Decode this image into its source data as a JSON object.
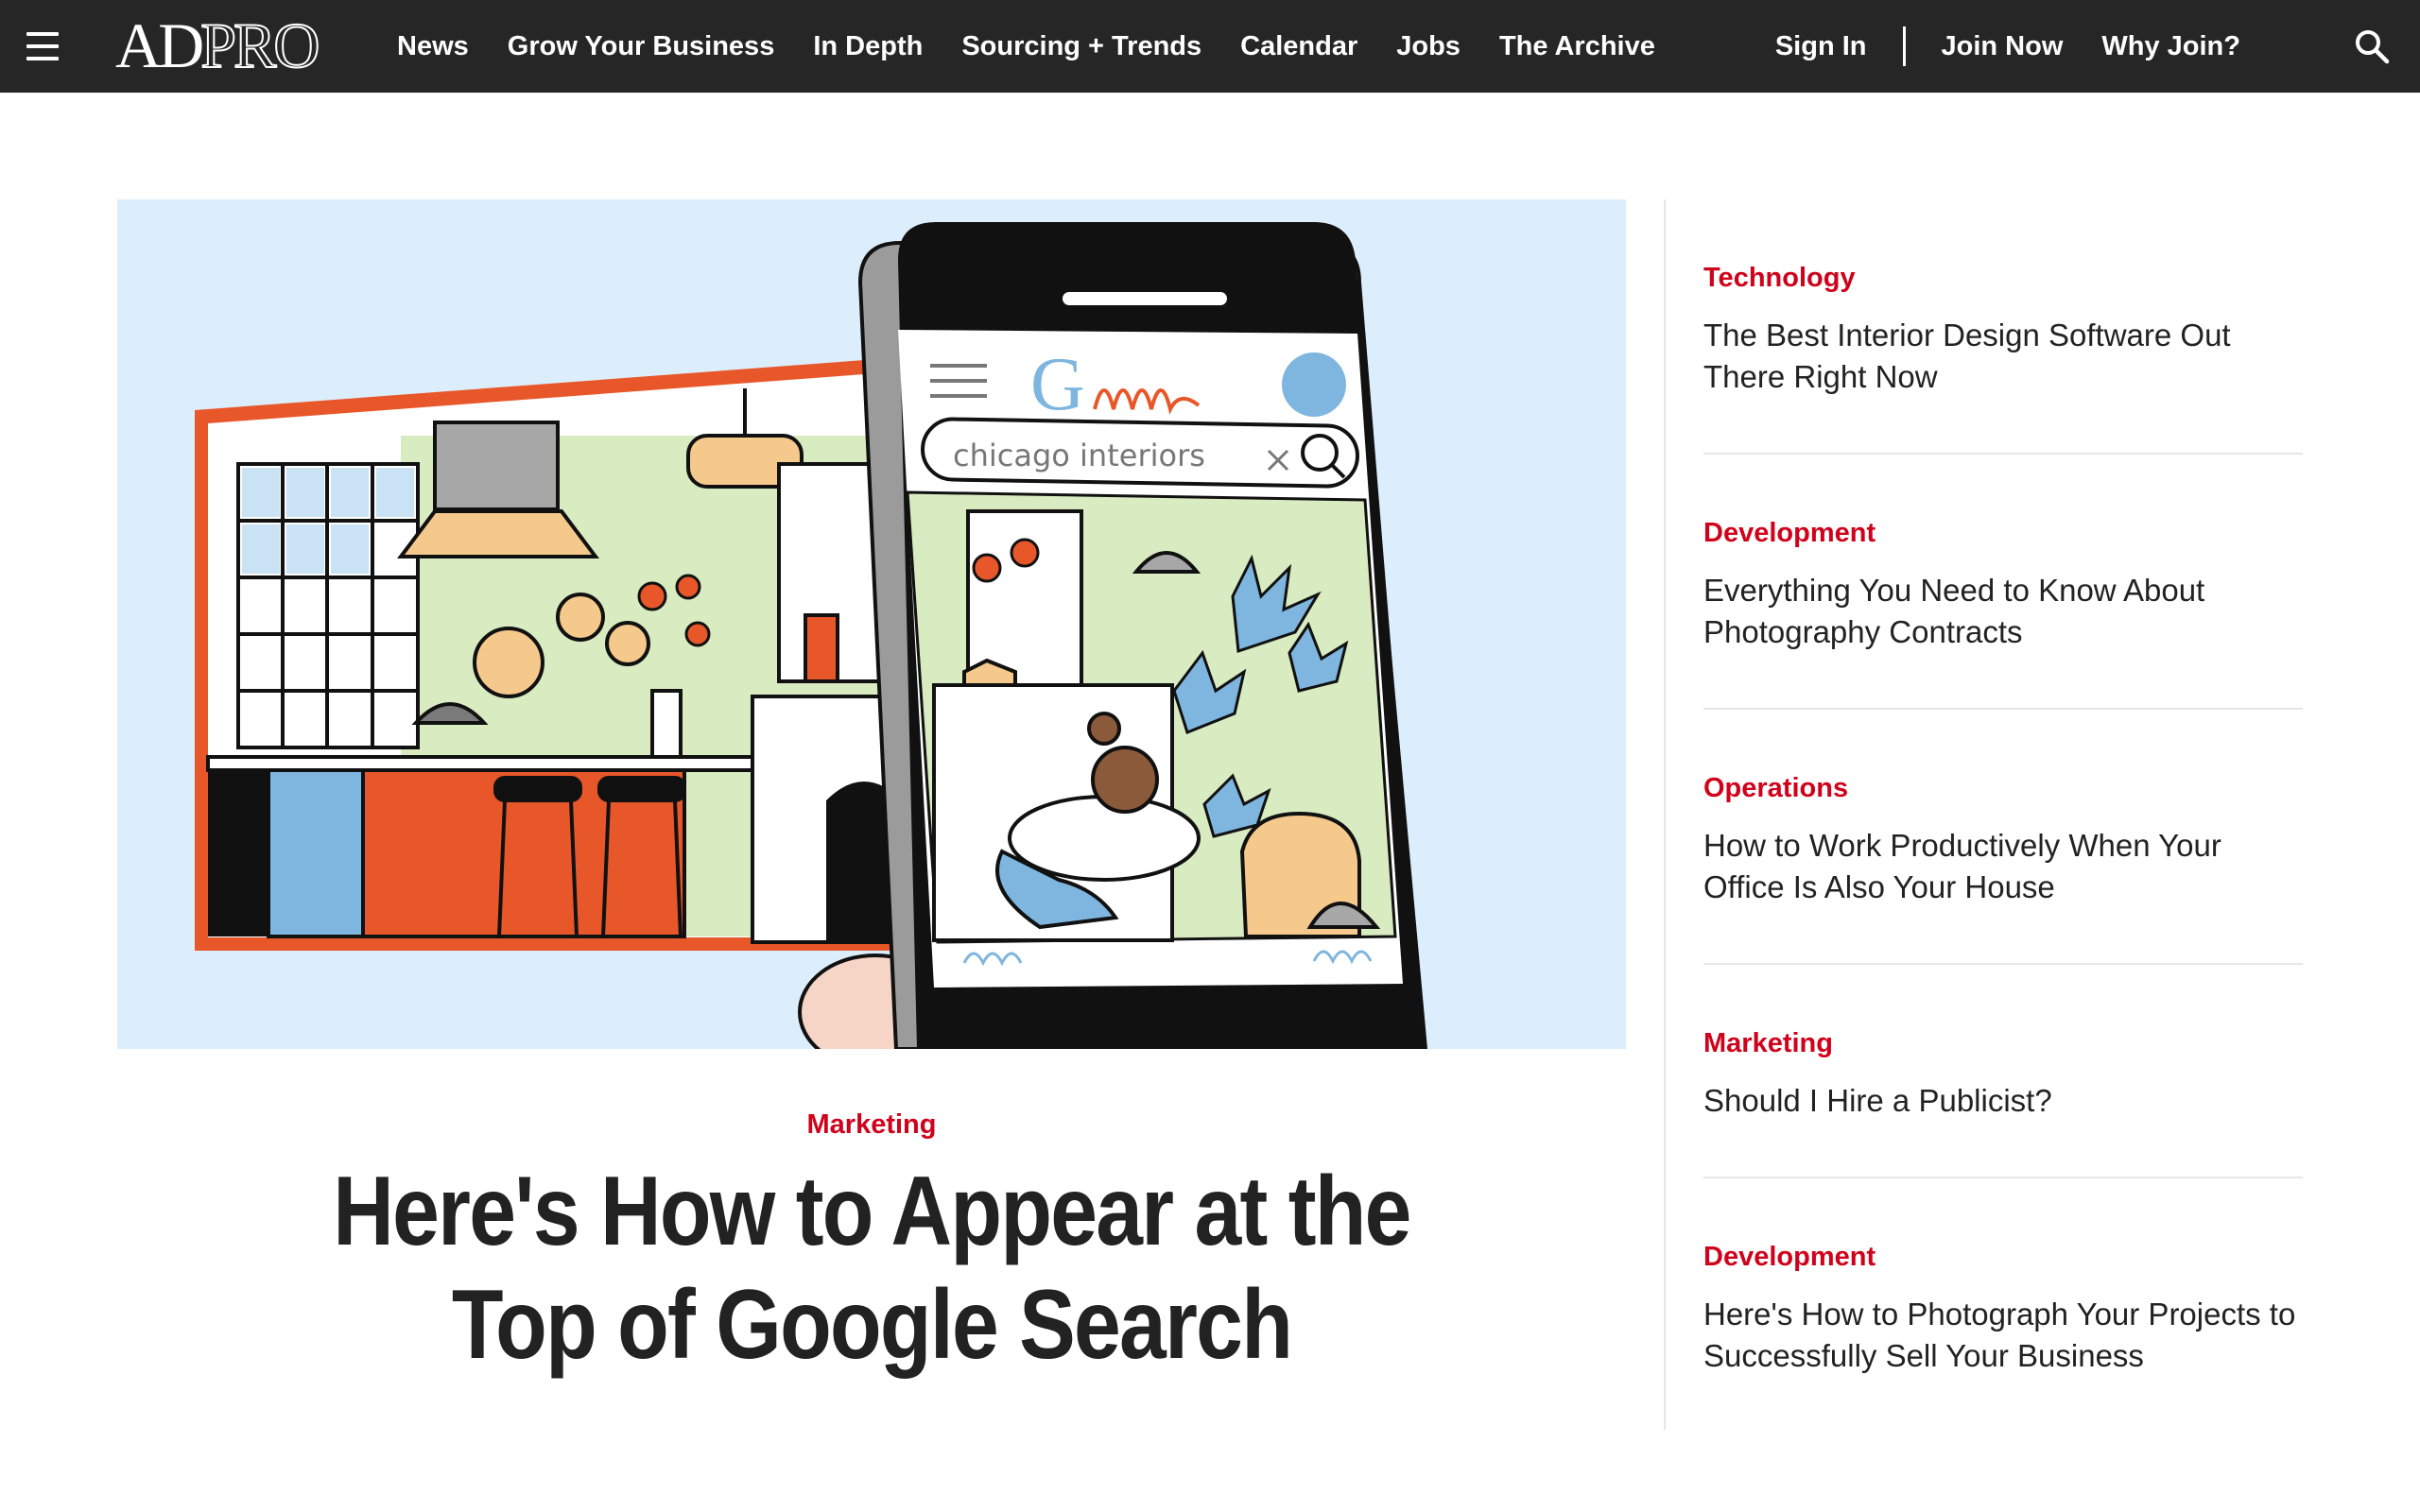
{
  "header": {
    "logo_text": "ADPRO",
    "nav": [
      "News",
      "Grow Your Business",
      "In Depth",
      "Sourcing + Trends",
      "Calendar",
      "Jobs",
      "The Archive"
    ],
    "sign_in": "Sign In",
    "join_now": "Join Now",
    "why_join": "Why Join?",
    "icons": [
      "hamburger-menu-icon",
      "search-icon"
    ]
  },
  "hero": {
    "search_query": "chicago interiors",
    "search_logo": "Gllu"
  },
  "article": {
    "category": "Marketing",
    "title": "Here's How to Appear at the Top of Google Search"
  },
  "sidebar": {
    "items": [
      {
        "category": "Technology",
        "title": "The Best Interior Design Software Out There Right Now"
      },
      {
        "category": "Development",
        "title": "Everything You Need to Know About Photography Contracts"
      },
      {
        "category": "Operations",
        "title": "How to Work Productively When Your Office Is Also Your House"
      },
      {
        "category": "Marketing",
        "title": "Should I Hire a Publicist?"
      },
      {
        "category": "Development",
        "title": "Here's How to Photograph Your Projects to Successfully Sell Your Business"
      }
    ]
  },
  "colors": {
    "topbar": "#262626",
    "accent_red": "#d0021b",
    "hero_bg": "#dceefb"
  }
}
